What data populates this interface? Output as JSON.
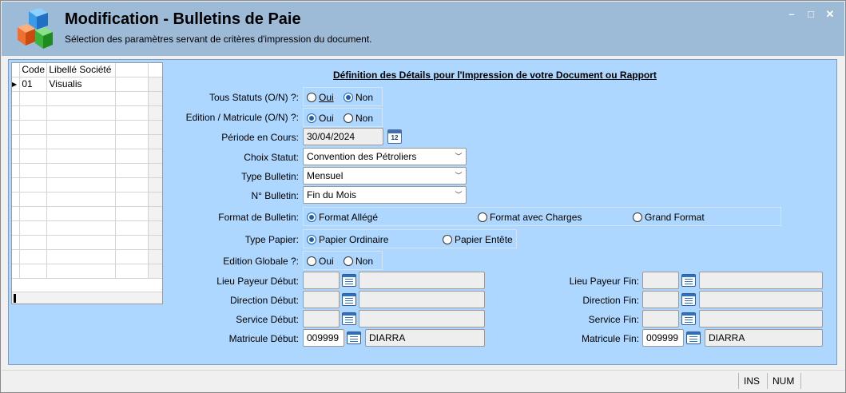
{
  "window": {
    "title": "Modification - Bulletins de Paie",
    "subtitle": "Sélection des paramètres servant de critères d'impression du document.",
    "controls": {
      "minimize": "–",
      "maximize": "□",
      "close": "✕"
    }
  },
  "grid": {
    "columns": [
      "Code",
      "Libellé Société"
    ],
    "rows": [
      {
        "code": "01",
        "libelle": "Visualis"
      }
    ]
  },
  "form": {
    "section_title": "Définition des Détails pour l'Impression de votre Document ou Rapport",
    "tous_statuts": {
      "label": "Tous Statuts (O/N) ?:",
      "opt_oui": "Oui",
      "opt_non": "Non",
      "selected": "Non"
    },
    "edition_matricule": {
      "label": "Edition / Matricule (O/N) ?:",
      "opt_oui": "Oui",
      "opt_non": "Non",
      "selected": "Oui"
    },
    "periode": {
      "label": "Période en Cours:",
      "value": "30/04/2024",
      "calendar_text": "12"
    },
    "choix_statut": {
      "label": "Choix Statut:",
      "value": "Convention des Pétroliers"
    },
    "type_bulletin": {
      "label": "Type Bulletin:",
      "value": "Mensuel"
    },
    "num_bulletin": {
      "label": "N° Bulletin:",
      "value": "Fin du Mois"
    },
    "format_bulletin": {
      "label": "Format de Bulletin:",
      "opt1": "Format Allégé",
      "opt2": "Format  avec Charges",
      "opt3": "Grand Format",
      "selected": "Format Allégé"
    },
    "type_papier": {
      "label": "Type Papier:",
      "opt1": "Papier Ordinaire",
      "opt2": "Papier Entête",
      "selected": "Papier Ordinaire"
    },
    "edition_globale": {
      "label": "Edition Globale ?:",
      "opt_oui": "Oui",
      "opt_non": "Non",
      "selected": "Oui"
    },
    "lieu_payeur_debut": {
      "label": "Lieu Payeur Début:",
      "code": "",
      "libelle": ""
    },
    "direction_debut": {
      "label": "Direction Début:",
      "code": "",
      "libelle": ""
    },
    "service_debut": {
      "label": "Service Début:",
      "code": "",
      "libelle": ""
    },
    "matricule_debut": {
      "label": "Matricule Début:",
      "code": "009999",
      "libelle": "DIARRA"
    },
    "lieu_payeur_fin": {
      "label": "Lieu Payeur Fin:",
      "code": "",
      "libelle": ""
    },
    "direction_fin": {
      "label": "Direction Fin:",
      "code": "",
      "libelle": ""
    },
    "service_fin": {
      "label": "Service Fin:",
      "code": "",
      "libelle": ""
    },
    "matricule_fin": {
      "label": "Matricule Fin:",
      "code": "009999",
      "libelle": "DIARRA"
    }
  },
  "statusbar": {
    "ins": "INS",
    "num": "NUM"
  },
  "colors": {
    "header_bg": "#9dbad6",
    "panel_bg": "#aed7ff",
    "radio_accent": "#1e5fb3"
  },
  "icons": [
    "app-logo-cubes-icon",
    "calendar-icon",
    "list-picker-icon",
    "dropdown-arrow-icon",
    "row-pointer-icon"
  ]
}
